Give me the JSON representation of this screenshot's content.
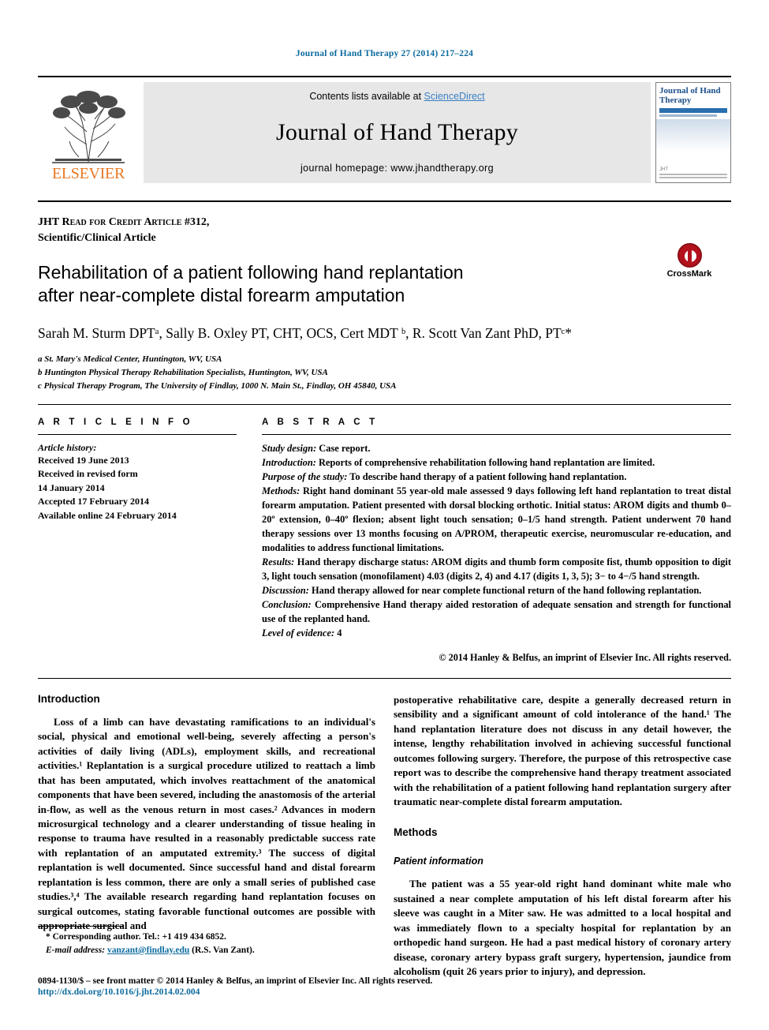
{
  "running_head": "Journal of Hand Therapy 27 (2014) 217–224",
  "masthead": {
    "contents_prefix": "Contents lists available at ",
    "sciencedirect": "ScienceDirect",
    "journal_title": "Journal of Hand Therapy",
    "homepage": "journal homepage: www.jhandtherapy.org",
    "publisher_name": "ELSEVIER",
    "publisher_logo_icon": "elsevier-tree-icon",
    "cover_title": "Journal of Hand Therapy"
  },
  "article": {
    "credit_line": "JHT Read for Credit Article #312,",
    "type_line": "Scientific/Clinical Article",
    "title_line1": "Rehabilitation of a patient following hand replantation",
    "title_line2": "after near-complete distal forearm amputation",
    "crossmark_label": "CrossMark",
    "crossmark_icon": "crossmark-icon",
    "authors": "Sarah M. Sturm DPTᵃ, Sally B. Oxley PT, CHT, OCS, Cert MDT ᵇ, R. Scott Van Zant PhD, PTᶜ*",
    "affiliations": [
      "a St. Mary's Medical Center, Huntington, WV, USA",
      "b Huntington Physical Therapy Rehabilitation Specialists, Huntington, WV, USA",
      "c Physical Therapy Program, The University of Findlay, 1000 N. Main St., Findlay, OH 45840, USA"
    ]
  },
  "info": {
    "heading": "A R T I C L E  I N F O",
    "history_label": "Article history:",
    "history": [
      "Received 19 June 2013",
      "Received in revised form",
      "14 January 2014",
      "Accepted 17 February 2014",
      "Available online 24 February 2014"
    ]
  },
  "abstract": {
    "heading": "A B S T R A C T",
    "entries": [
      {
        "label": "Study design:",
        "text": " Case report."
      },
      {
        "label": "Introduction:",
        "text": " Reports of comprehensive rehabilitation following hand replantation are limited."
      },
      {
        "label": "Purpose of the study:",
        "text": " To describe hand therapy of a patient following hand replantation."
      },
      {
        "label": "Methods:",
        "text": " Right hand dominant 55 year-old male assessed 9 days following left hand replantation to treat distal forearm amputation. Patient presented with dorsal blocking orthotic. Initial status: AROM digits and thumb 0–20º extension, 0–40º flexion; absent light touch sensation; 0–1/5 hand strength. Patient underwent 70 hand therapy sessions over 13 months focusing on A/PROM, therapeutic exercise, neuromuscular re-education, and modalities to address functional limitations."
      },
      {
        "label": "Results:",
        "text": " Hand therapy discharge status: AROM digits and thumb form composite fist, thumb opposition to digit 3, light touch sensation (monofilament) 4.03 (digits 2, 4) and 4.17 (digits 1, 3, 5); 3− to 4−/5 hand strength."
      },
      {
        "label": "Discussion:",
        "text": " Hand therapy allowed for near complete functional return of the hand following replantation."
      },
      {
        "label": "Conclusion:",
        "text": " Comprehensive Hand therapy aided restoration of adequate sensation and strength for functional use of the replanted hand."
      },
      {
        "label": "Level of evidence:",
        "text": " 4"
      }
    ],
    "copyright": "© 2014 Hanley & Belfus, an imprint of Elsevier Inc. All rights reserved."
  },
  "body": {
    "left": {
      "heading": "Introduction",
      "paragraph": "Loss of a limb can have devastating ramifications to an individual's social, physical and emotional well-being, severely affecting a person's activities of daily living (ADLs), employment skills, and recreational activities.¹ Replantation is a surgical procedure utilized to reattach a limb that has been amputated, which involves reattachment of the anatomical components that have been severed, including the anastomosis of the arterial in-flow, as well as the venous return in most cases.² Advances in modern microsurgical technology and a clearer understanding of tissue healing in response to trauma have resulted in a reasonably predictable success rate with replantation of an amputated extremity.³ The success of digital replantation is well documented. Since successful hand and distal forearm replantation is less common, there are only a small series of published case studies.³,⁴ The available research regarding hand replantation focuses on surgical outcomes, stating favorable functional outcomes are possible with appropriate surgical and"
    },
    "right": {
      "continued": "postoperative rehabilitative care, despite a generally decreased return in sensibility and a significant amount of cold intolerance of the hand.¹ The hand replantation literature does not discuss in any detail however, the intense, lengthy rehabilitation involved in achieving successful functional outcomes following surgery. Therefore, the purpose of this retrospective case report was to describe the comprehensive hand therapy treatment associated with the rehabilitation of a patient following hand replantation surgery after traumatic near-complete distal forearm amputation.",
      "methods_heading": "Methods",
      "patient_info_heading": "Patient information",
      "patient_paragraph": "The patient was a 55 year-old right hand dominant white male who sustained a near complete amputation of his left distal forearm after his sleeve was caught in a Miter saw. He was admitted to a local hospital and was immediately flown to a specialty hospital for replantation by an orthopedic hand surgeon. He had a past medical history of coronary artery disease, coronary artery bypass graft surgery, hypertension, jaundice from alcoholism (quit 26 years prior to injury), and depression."
    }
  },
  "footnotes": {
    "corresponding": "* Corresponding author. Tel.: +1 419 434 6852.",
    "email_label": "E-mail address:",
    "email": "vanzant@findlay.edu",
    "email_owner": " (R.S. Van Zant)."
  },
  "page_footer": {
    "issn_line": "0894-1130/$ – see front matter © 2014 Hanley & Belfus, an imprint of Elsevier Inc. All rights reserved.",
    "doi": "http://dx.doi.org/10.1016/j.jht.2014.02.004"
  },
  "colors": {
    "link": "#0b6a9e",
    "sciencedirect": "#3a7fc4",
    "elsevier_orange": "#e87722",
    "superscript": "#1a5fa8",
    "crossmark_red": "#b3121d"
  }
}
